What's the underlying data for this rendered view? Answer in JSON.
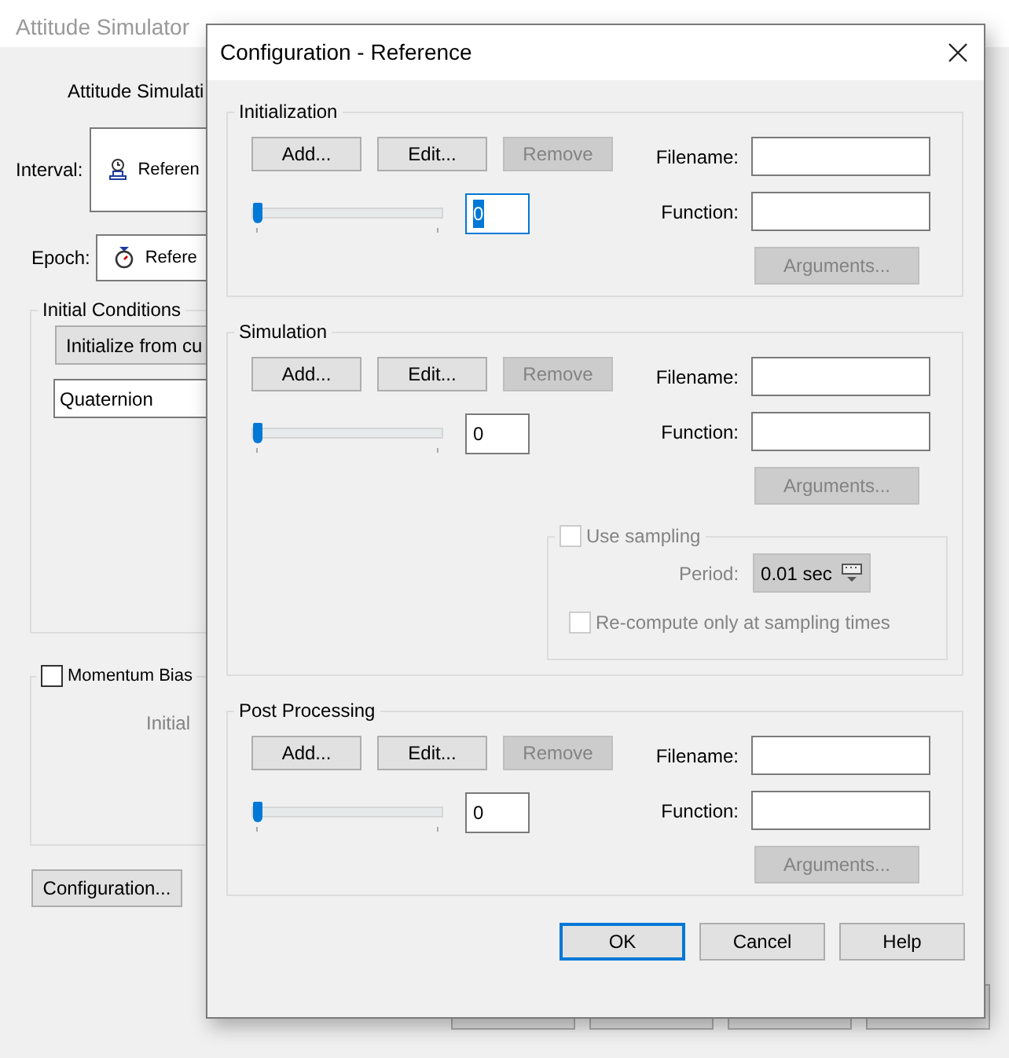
{
  "main_window": {
    "title": "Attitude Simulator",
    "heading": "Attitude Simulati",
    "interval": {
      "label": "Interval:",
      "value": "Referen"
    },
    "epoch": {
      "label": "Epoch:",
      "value": "Refere"
    },
    "initial_conditions": {
      "title": "Initial Conditions",
      "button": "Initialize from cu",
      "field": "Quaternion"
    },
    "momentum_bias": {
      "label": "Momentum Bias",
      "checked": false,
      "initial_label": "Initial"
    },
    "configuration_button": "Configuration..."
  },
  "dialog": {
    "title": "Configuration - Reference",
    "sections": [
      {
        "title": "Initialization",
        "buttons": [
          {
            "label": "Add...",
            "disabled": false
          },
          {
            "label": "Edit...",
            "disabled": false
          },
          {
            "label": "Remove",
            "disabled": true
          }
        ],
        "level": 0,
        "count": "0",
        "count_focused": true,
        "filename_label": "Filename:",
        "function_label": "Function:",
        "arguments": {
          "label": "Arguments...",
          "disabled": true
        }
      },
      {
        "title": "Simulation",
        "buttons": [
          {
            "label": "Add...",
            "disabled": false
          },
          {
            "label": "Edit...",
            "disabled": false
          },
          {
            "label": "Remove",
            "disabled": true
          }
        ],
        "level": 0,
        "count": "0",
        "count_focused": false,
        "filename_label": "Filename:",
        "function_label": "Function:",
        "arguments": {
          "label": "Arguments...",
          "disabled": true
        },
        "sampling": {
          "label": "Use sampling",
          "checked": false,
          "disabled": true,
          "period_label": "Period:",
          "period_value": "0.01 sec",
          "recompute_label": "Re-compute only at sampling times",
          "recompute_checked": false
        }
      },
      {
        "title": "Post Processing",
        "buttons": [
          {
            "label": "Add...",
            "disabled": false
          },
          {
            "label": "Edit...",
            "disabled": false
          },
          {
            "label": "Remove",
            "disabled": true
          }
        ],
        "level": 0,
        "count": "0",
        "count_focused": false,
        "filename_label": "Filename:",
        "function_label": "Function:",
        "arguments": {
          "label": "Arguments...",
          "disabled": true
        }
      }
    ],
    "footer_buttons": [
      {
        "label": "OK",
        "default": true
      },
      {
        "label": "Cancel",
        "default": false
      },
      {
        "label": "Help",
        "default": false
      }
    ]
  }
}
